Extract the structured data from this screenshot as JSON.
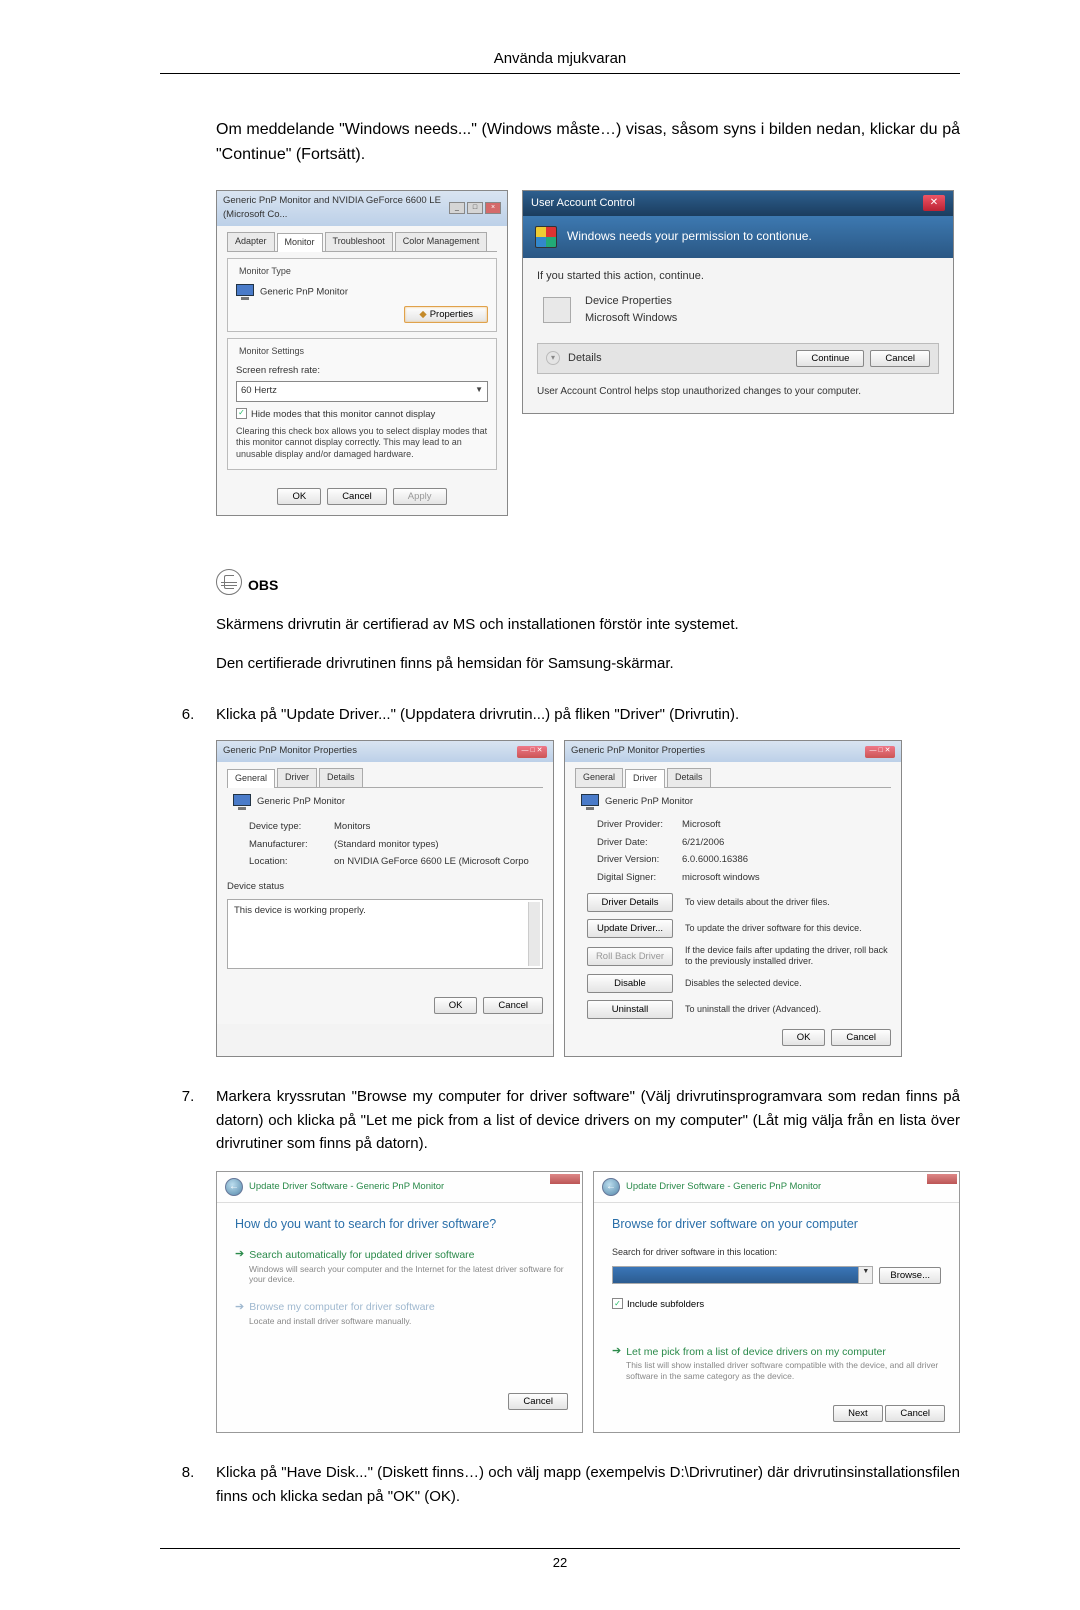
{
  "header": {
    "title": "Använda mjukvaran"
  },
  "intro": "Om meddelande \"Windows needs...\" (Windows måste…) visas, såsom syns i bilden nedan, klickar du på \"Continue\" (Fortsätt).",
  "monitor_dialog": {
    "title": "Generic PnP Monitor and NVIDIA GeForce 6600 LE (Microsoft Co...",
    "tabs": {
      "adapter": "Adapter",
      "monitor": "Monitor",
      "troubleshoot": "Troubleshoot",
      "color": "Color Management"
    },
    "monitor_type_label": "Monitor Type",
    "monitor_type_value": "Generic PnP Monitor",
    "properties_btn": "Properties",
    "settings_label": "Monitor Settings",
    "refresh_label": "Screen refresh rate:",
    "refresh_value": "60 Hertz",
    "hide_modes": "Hide modes that this monitor cannot display",
    "hide_desc": "Clearing this check box allows you to select display modes that this monitor cannot display correctly. This may lead to an unusable display and/or damaged hardware.",
    "ok": "OK",
    "cancel": "Cancel",
    "apply": "Apply"
  },
  "uac": {
    "title": "User Account Control",
    "headline": "Windows needs your permission to contionue.",
    "started": "If you started this action, continue.",
    "program": "Device Properties",
    "publisher": "Microsoft Windows",
    "details": "Details",
    "continue": "Continue",
    "cancel": "Cancel",
    "footnote": "User Account Control helps stop unauthorized changes to your computer."
  },
  "obs": {
    "label": "OBS",
    "line1": "Skärmens drivrutin är certifierad av MS och installationen förstör inte systemet.",
    "line2": "Den certifierade drivrutinen finns på hemsidan för Samsung-skärmar."
  },
  "steps": {
    "s6": {
      "num": "6.",
      "text": "Klicka på \"Update Driver...\" (Uppdatera drivrutin...) på fliken \"Driver\" (Drivrutin)."
    },
    "s7": {
      "num": "7.",
      "text": "Markera kryssrutan \"Browse my computer for driver software\" (Välj drivrutinsprogramvara som redan finns på datorn) och klicka på \"Let me pick from a list of device drivers on my computer\" (Låt mig välja från en lista över drivrutiner som finns på datorn)."
    },
    "s8": {
      "num": "8.",
      "text": "Klicka på \"Have Disk...\" (Diskett finns…) och välj mapp (exempelvis D:\\Drivrutiner) där drivrutinsinstallationsfilen finns och klicka sedan på \"OK\" (OK)."
    }
  },
  "props_general": {
    "title": "Generic PnP Monitor Properties",
    "tabs": {
      "general": "General",
      "driver": "Driver",
      "details": "Details"
    },
    "device": "Generic PnP Monitor",
    "fields": {
      "type_k": "Device type:",
      "type_v": "Monitors",
      "manu_k": "Manufacturer:",
      "manu_v": "(Standard monitor types)",
      "loc_k": "Location:",
      "loc_v": "on NVIDIA GeForce 6600 LE (Microsoft Corpo"
    },
    "status_label": "Device status",
    "status_text": "This device is working properly.",
    "ok": "OK",
    "cancel": "Cancel"
  },
  "props_driver": {
    "title": "Generic PnP Monitor Properties",
    "tabs": {
      "general": "General",
      "driver": "Driver",
      "details": "Details"
    },
    "device": "Generic PnP Monitor",
    "fields": {
      "prov_k": "Driver Provider:",
      "prov_v": "Microsoft",
      "date_k": "Driver Date:",
      "date_v": "6/21/2006",
      "ver_k": "Driver Version:",
      "ver_v": "6.0.6000.16386",
      "sign_k": "Digital Signer:",
      "sign_v": "microsoft windows"
    },
    "buttons": {
      "details": "Driver Details",
      "details_d": "To view details about the driver files.",
      "update": "Update Driver...",
      "update_d": "To update the driver software for this device.",
      "rollback": "Roll Back Driver",
      "rollback_d": "If the device fails after updating the driver, roll back to the previously installed driver.",
      "disable": "Disable",
      "disable_d": "Disables the selected device.",
      "uninstall": "Uninstall",
      "uninstall_d": "To uninstall the driver (Advanced)."
    },
    "ok": "OK",
    "cancel": "Cancel"
  },
  "wiz1": {
    "crumb": "Update Driver Software - Generic PnP Monitor",
    "headline": "How do you want to search for driver software?",
    "opt1_title": "Search automatically for updated driver software",
    "opt1_sub": "Windows will search your computer and the Internet for the latest driver software for your device.",
    "opt2_title": "Browse my computer for driver software",
    "opt2_sub": "Locate and install driver software manually.",
    "cancel": "Cancel"
  },
  "wiz2": {
    "crumb": "Update Driver Software - Generic PnP Monitor",
    "headline": "Browse for driver software on your computer",
    "loc_label": "Search for driver software in this location:",
    "browse": "Browse...",
    "include": "Include subfolders",
    "opt_title": "Let me pick from a list of device drivers on my computer",
    "opt_sub": "This list will show installed driver software compatible with the device, and all driver software in the same category as the device.",
    "next": "Next",
    "cancel": "Cancel"
  },
  "page_number": "22"
}
